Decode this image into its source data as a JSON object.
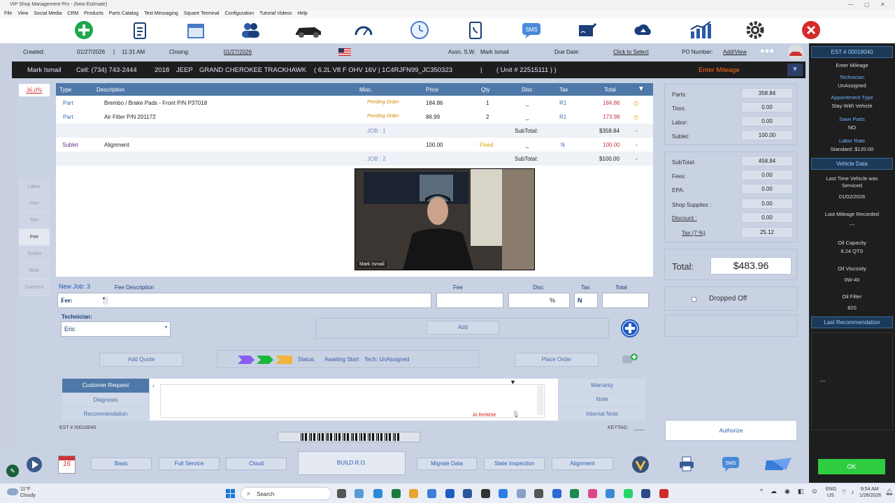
{
  "window": {
    "title": "VIP Shop Management Pro  - (New Estimate)"
  },
  "menu": [
    "File",
    "View",
    "Social Media",
    "CRM",
    "Products",
    "Parts Catalog",
    "Text Messaging",
    "Square Terminal",
    "Configuration",
    "Tutorial Videos",
    "Help"
  ],
  "toolbar_icons": [
    "add-icon",
    "clipboard-icon",
    "calendar-icon",
    "customers-icon",
    "car-icon",
    "gauge-icon",
    "clock-icon",
    "phonebook-icon",
    "sms-icon",
    "signature-icon",
    "cloud-upload-icon",
    "chart-icon",
    "gear-icon",
    "close-icon"
  ],
  "header": {
    "created_label": "Created:",
    "created_date": "01/27/2026",
    "created_sep": "|",
    "created_time": "11:31 AM",
    "closing_label": "Closing:",
    "closing_date": "01/27/2026",
    "assn_label": "Assn. S.W.",
    "assn_value": "Mark Ismail",
    "due_label": "Due Date:",
    "due_value": "Click to Select",
    "po_label": "PO Number:",
    "po_value": "Add/View"
  },
  "vehicle": {
    "customer": "Mark Ismail",
    "cell": "Cell: (734) 743-2444",
    "year": "2018",
    "make": "JEEP",
    "model": "GRAND CHEROKEE TRACKHAWK",
    "engine": "( 6.2L V8    F OHV  16V | 1C4RJFN99_JC350323",
    "sep": "|",
    "unit": "( Unit # 22515111 ) )",
    "mileage": "Enter Mileage"
  },
  "discount_pct": "36.0%",
  "side_tabs": [
    "Labor",
    "Part",
    "Tire",
    "Fee",
    "Sublet",
    "Note",
    "Concern"
  ],
  "grid": {
    "headers": {
      "type": "Type",
      "desc": "Description",
      "misc": "Misc.",
      "price": "Price",
      "qty": "Qty",
      "disc": "Disc",
      "tax": "Tax",
      "total": "Total"
    },
    "rows": [
      {
        "type": "Part",
        "desc": "Brembo / Brake Pads - Front P/N P37018",
        "misc": "Pending Order",
        "price": "184.86",
        "qty": "1",
        "disc": "_",
        "tax": "R1",
        "total": "184.86"
      },
      {
        "type": "Part",
        "desc": "Air Filter P/N 201172",
        "misc": "Pending Order",
        "price": "86.99",
        "qty": "2",
        "disc": "_",
        "tax": "R1",
        "total": "173.98"
      },
      {
        "job": "JOB : 1",
        "subtotal_label": "SubTotal:",
        "subtotal": "$358.84",
        "dash": "-"
      },
      {
        "type": "Sublet",
        "desc": "Alignment",
        "misc": "",
        "price": "100.00",
        "qty": "Fixed",
        "disc": "_",
        "tax": "N",
        "total": "100.00"
      },
      {
        "job": "JOB : 2",
        "subtotal_label": "SubTotal:",
        "subtotal": "$100.00",
        "dash": "-"
      }
    ]
  },
  "video": {
    "name": "Mark Ismail"
  },
  "new_job": {
    "title": "New Job: 3",
    "fee_desc_label": "Fee Description",
    "fee_label": "Fee",
    "disc_label": "Disc",
    "tax_label": "Tax",
    "total_label": "Total",
    "fee_prefix": "Fee:",
    "disc_unit": "%",
    "tax_value": "N",
    "tech_label": "Technician:",
    "tech_value": "Eric",
    "add_label": "Add"
  },
  "status_bar": {
    "add_quote": "Add Quote",
    "status": "Status:",
    "status_value": "Awaiting Start",
    "tech": "Tech: UnAssigned",
    "place_order": "Place Order"
  },
  "notes": {
    "customer_request": "Customer Request",
    "diagnosis": "Diagnosis",
    "recommendation": "Recommendation",
    "warranty": "Warranty",
    "note": "Note",
    "internal_note": "Internal Note",
    "ai_rewrite": "AI ReWrite"
  },
  "footer_info": {
    "est": "EST # 00018040",
    "keytag": "KEYTAG:",
    "keytag_value": "____"
  },
  "totals": {
    "parts_label": "Parts:",
    "parts": "358.84",
    "tires_label": "Tires:",
    "tires": "0.00",
    "labor_label": "Labor:",
    "labor": "0.00",
    "sublet_label": "Sublet:",
    "sublet": "100.00",
    "subtotal_label": "SubTotal:",
    "subtotal": "458.84",
    "fees_label": "Fees:",
    "fees": "0.00",
    "epa_label": "EPA:",
    "epa": "0.00",
    "supplies_label": "Shop Supplies :",
    "supplies": "0.00",
    "discount_label": "Discount :",
    "discount": "0.00",
    "tax_label": "Tax (7 %)",
    "tax": "25.12",
    "total_label": "Total:",
    "total": "$483.96",
    "dropped_off": "Dropped Off",
    "authorize": "Authorize"
  },
  "sidebar": {
    "est": "EST # 00018040",
    "mileage": "Enter Mileage",
    "tech_label": "Technician",
    "tech": "UnAssigned",
    "appt_label": "Appointment Type",
    "appt": "Stay With Vehicle",
    "save_parts_label": "Save Parts",
    "save_parts": "NO",
    "labor_rate_label": "Labor Rate",
    "labor_rate": "Standard: $120.00",
    "vehicle_data": "Vehicle Data",
    "last_service_label": "Last Time Vehicle was Serviced",
    "last_service": "01/02/2026",
    "last_mileage_label": "Last Mileage Recorded",
    "last_mileage": "---",
    "oil_cap_label": "Oil Capacity",
    "oil_cap": "8.24  QTS",
    "oil_visc_label": "Oil Viscosity",
    "oil_visc": "0W-40",
    "oil_filter_label": "Oil Filter",
    "oil_filter": "820",
    "last_rec": "Last Recommendation",
    "rec_value": "---",
    "ok": "OK"
  },
  "bottom": {
    "basic": "Basic",
    "full_service": "Full Service",
    "cloud": "Cloud",
    "build": "BUILD R.O.",
    "migrate": "Migrate Data",
    "state": "State Inspection",
    "alignment": "Alignment",
    "date_day": "16"
  },
  "taskbar": {
    "weather_temp": "11°F",
    "weather_desc": "Cloudy",
    "search": "Search",
    "lang1": "ENG",
    "lang2": "US",
    "time": "9:54 AM",
    "date": "1/28/2026"
  },
  "colors": {
    "accent": "#4e78a8",
    "dark": "#1e1e1e",
    "ok_green": "#2ecc40",
    "mileage_orange": "#ff6600"
  }
}
